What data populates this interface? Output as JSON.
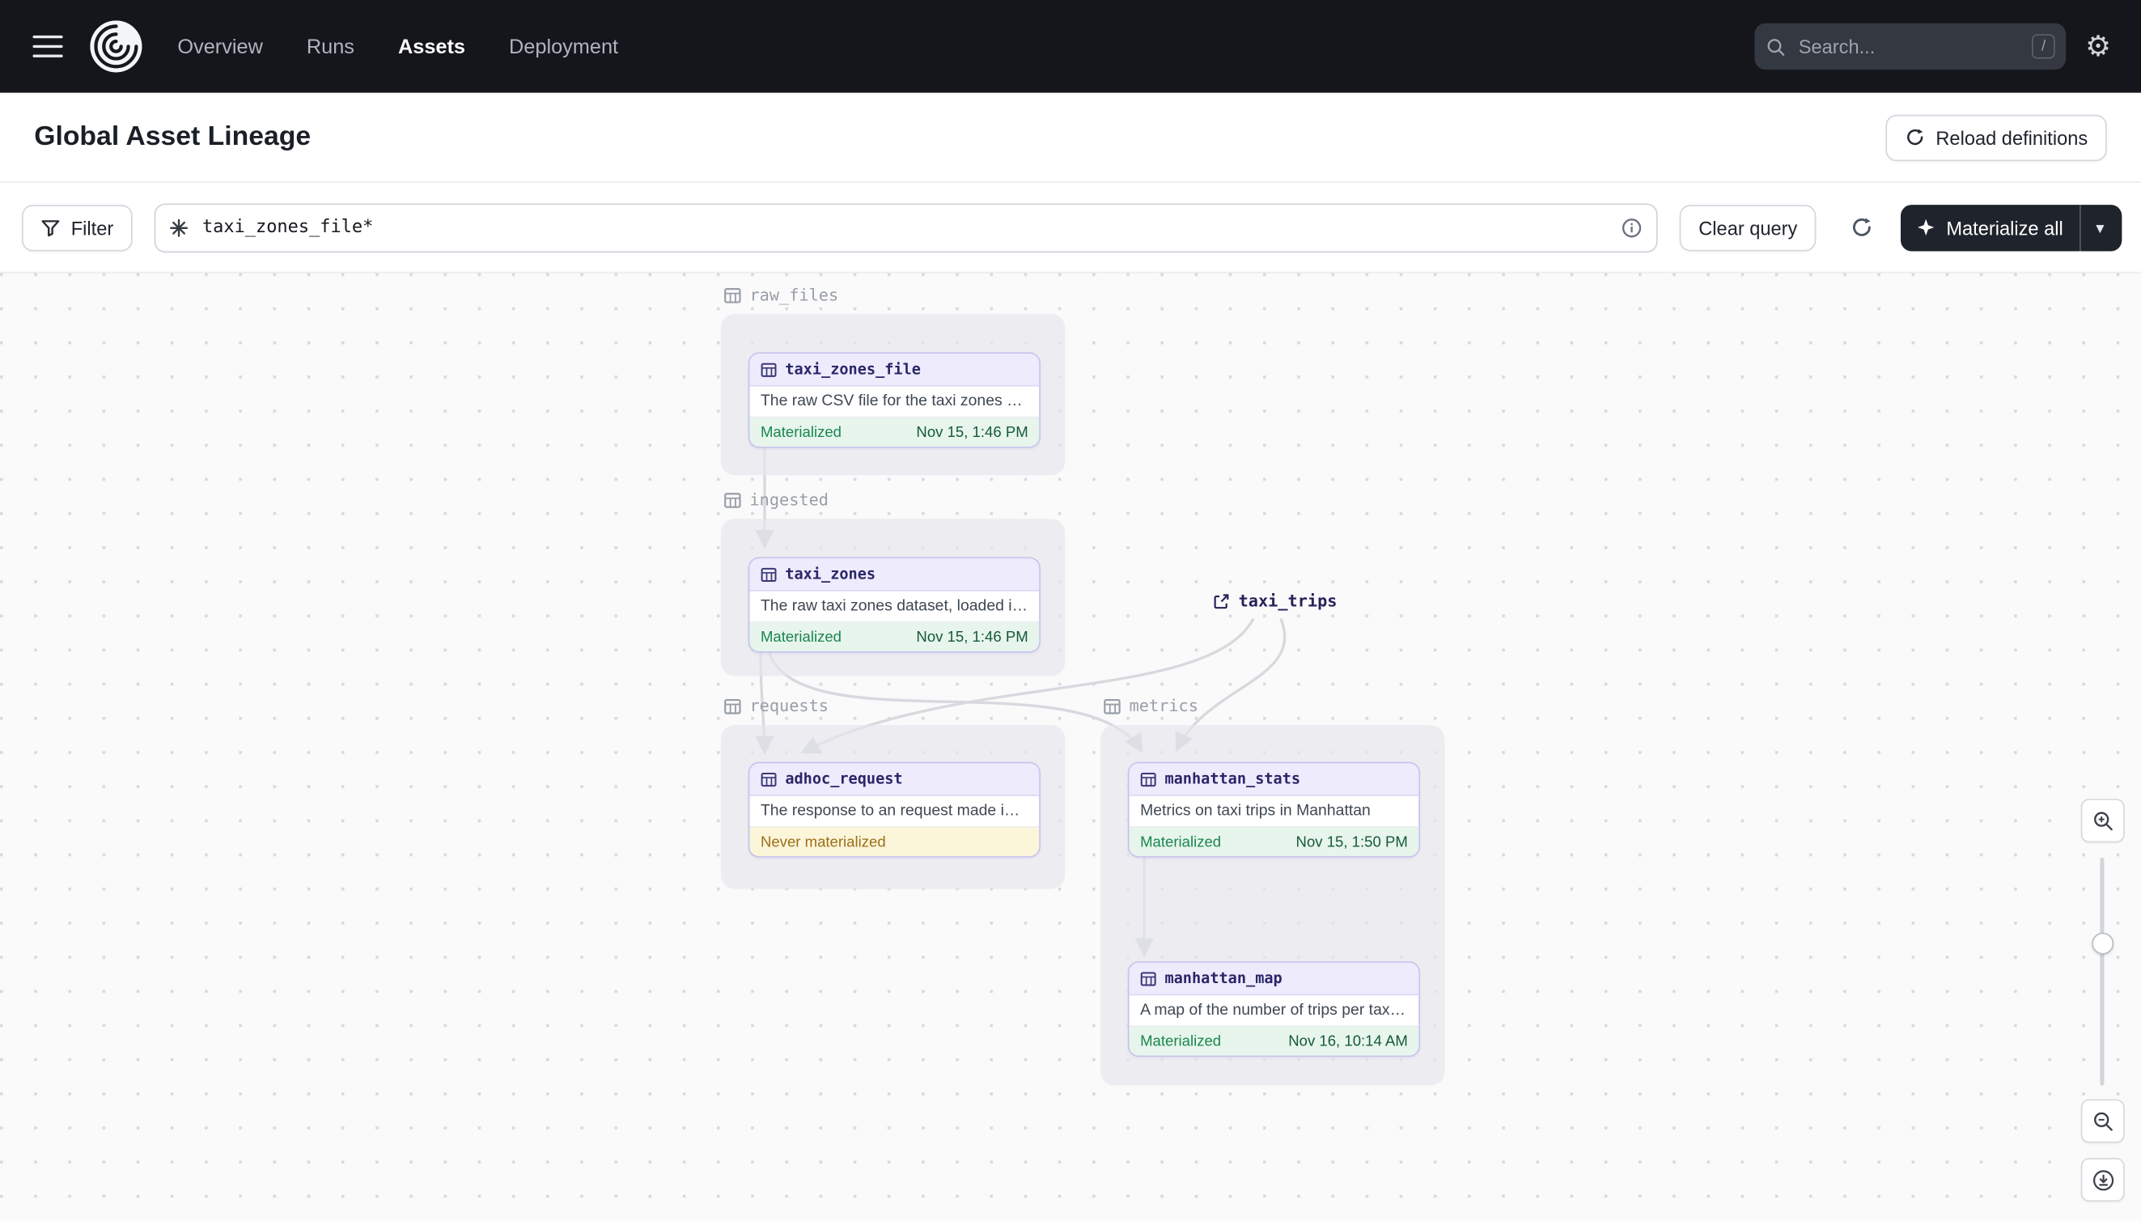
{
  "colors": {
    "topnav_bg": "#14161c",
    "accent_green": "#19864f",
    "accent_amber": "#9c6f19",
    "node_border": "#c6c3ee",
    "node_header_bg": "#edebfc",
    "materialize_button_bg": "#1f232b"
  },
  "nav": {
    "items": [
      {
        "label": "Overview",
        "active": false
      },
      {
        "label": "Runs",
        "active": false
      },
      {
        "label": "Assets",
        "active": true
      },
      {
        "label": "Deployment",
        "active": false
      }
    ],
    "search": {
      "placeholder": "Search...",
      "shortcut": "/"
    }
  },
  "icons": {
    "gear": "⚙",
    "caret_down": "▾"
  },
  "header": {
    "title": "Global Asset Lineage",
    "reload_button_label": "Reload definitions"
  },
  "toolbar": {
    "filter_label": "Filter",
    "query_value": "taxi_zones_file*",
    "clear_query_label": "Clear query",
    "materialize_label": "Materialize all"
  },
  "graph": {
    "groups": [
      {
        "name": "raw_files"
      },
      {
        "name": "ingested"
      },
      {
        "name": "requests"
      },
      {
        "name": "metrics"
      }
    ],
    "nodes": [
      {
        "name": "taxi_zones_file",
        "group": "raw_files",
        "description": "The raw CSV file for the taxi zones dat…",
        "status": "Materialized",
        "timestamp": "Nov 15, 1:46 PM"
      },
      {
        "name": "taxi_zones",
        "group": "ingested",
        "description": "The raw taxi zones dataset, loaded int…",
        "status": "Materialized",
        "timestamp": "Nov 15, 1:46 PM"
      },
      {
        "name": "adhoc_request",
        "group": "requests",
        "description": "The response to an request made in th…",
        "status": "Never materialized",
        "timestamp": ""
      },
      {
        "name": "manhattan_stats",
        "group": "metrics",
        "description": "Metrics on taxi trips in Manhattan",
        "status": "Materialized",
        "timestamp": "Nov 15, 1:50 PM"
      },
      {
        "name": "manhattan_map",
        "group": "metrics",
        "description": "A map of the number of trips per taxi z…",
        "status": "Materialized",
        "timestamp": "Nov 16, 10:14 AM"
      }
    ],
    "external_assets": [
      {
        "name": "taxi_trips"
      }
    ]
  }
}
